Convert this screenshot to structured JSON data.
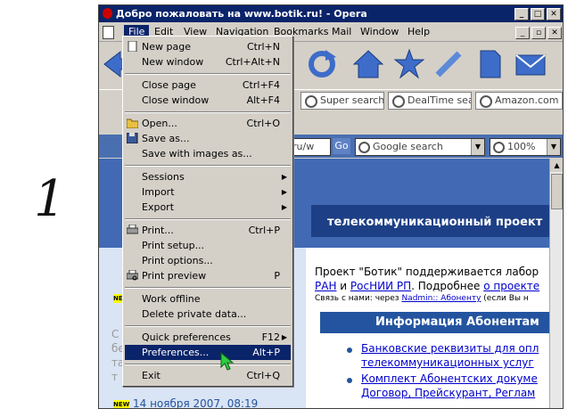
{
  "step_number": "1",
  "window": {
    "title": "Добро пожаловать на www.botik.ru! - Opera",
    "controls": {
      "minimize": "_",
      "maximize": "□",
      "close": "✕"
    },
    "restore_controls": {
      "minimize": "_",
      "restore": "▫",
      "close": "✕"
    }
  },
  "menubar": {
    "items": [
      "File",
      "Edit",
      "View",
      "Navigation",
      "Bookmarks",
      "Mail",
      "Window",
      "Help"
    ]
  },
  "search_bar": {
    "fields": [
      "Super search",
      "DealTime search",
      "Amazon.com se"
    ]
  },
  "address_bar": {
    "url_fragment": "ru/w",
    "go_label": "Go",
    "search_placeholder": "Google search",
    "zoom": "100%"
  },
  "page": {
    "header_banner": "телекоммуникационный проект",
    "intro_line1_prefix": "Проект \"Ботик\" поддерживается лабор",
    "intro_link_ran": "РАН",
    "intro_and": " и ",
    "intro_link_rosnii": "РосНИИ РП",
    "intro_more": ". Подробнее ",
    "intro_link_project": "о проекте",
    "contact_prefix": "Связь с нами: через ",
    "contact_link": "Nadmin:: Абоненту",
    "contact_suffix": " (если Вы н",
    "info_header": "Информация Абонентам",
    "bullets": [
      {
        "line1": "Банковские реквизиты для опл",
        "line2": "телекоммуникационных услуг"
      },
      {
        "line1": "Комплект Абонентских докуме",
        "line2": "Договор, Прейскурант, Реглам"
      }
    ],
    "news_date": "14 ноября 2007, 08:19",
    "news_badge": "NEW",
    "sidebar_fragments": [
      "С",
      "бе",
      "та",
      "т"
    ]
  },
  "file_menu": {
    "groups": [
      [
        {
          "label": "New page",
          "shortcut": "Ctrl+N",
          "icon": "new-page-icon"
        },
        {
          "label": "New window",
          "shortcut": "Ctrl+Alt+N",
          "icon": ""
        }
      ],
      [
        {
          "label": "Close page",
          "shortcut": "Ctrl+F4",
          "icon": ""
        },
        {
          "label": "Close window",
          "shortcut": "Alt+F4",
          "icon": ""
        }
      ],
      [
        {
          "label": "Open...",
          "shortcut": "Ctrl+O",
          "icon": "folder-icon"
        },
        {
          "label": "Save as...",
          "shortcut": "",
          "icon": "floppy-disk-icon"
        },
        {
          "label": "Save with images as...",
          "shortcut": "",
          "icon": ""
        }
      ],
      [
        {
          "label": "Sessions",
          "shortcut": "",
          "submenu": true
        },
        {
          "label": "Import",
          "shortcut": "",
          "submenu": true
        },
        {
          "label": "Export",
          "shortcut": "",
          "submenu": true
        }
      ],
      [
        {
          "label": "Print...",
          "shortcut": "Ctrl+P",
          "icon": "printer-icon"
        },
        {
          "label": "Print setup...",
          "shortcut": ""
        },
        {
          "label": "Print options...",
          "shortcut": ""
        },
        {
          "label": "Print preview",
          "shortcut": "P",
          "icon": "print-preview-icon"
        }
      ],
      [
        {
          "label": "Work offline",
          "shortcut": ""
        },
        {
          "label": "Delete private data...",
          "shortcut": ""
        }
      ],
      [
        {
          "label": "Quick preferences",
          "shortcut": "F12",
          "submenu": true
        },
        {
          "label": "Preferences...",
          "shortcut": "Alt+P",
          "highlighted": true
        }
      ],
      [
        {
          "label": "Exit",
          "shortcut": "Ctrl+Q"
        }
      ]
    ]
  },
  "colors": {
    "titlebar": "#0a246a",
    "menu_highlight": "#0a246a",
    "page_banner": "#4169b4",
    "info_header": "#2454a0",
    "cursor": "#2ecc40"
  }
}
